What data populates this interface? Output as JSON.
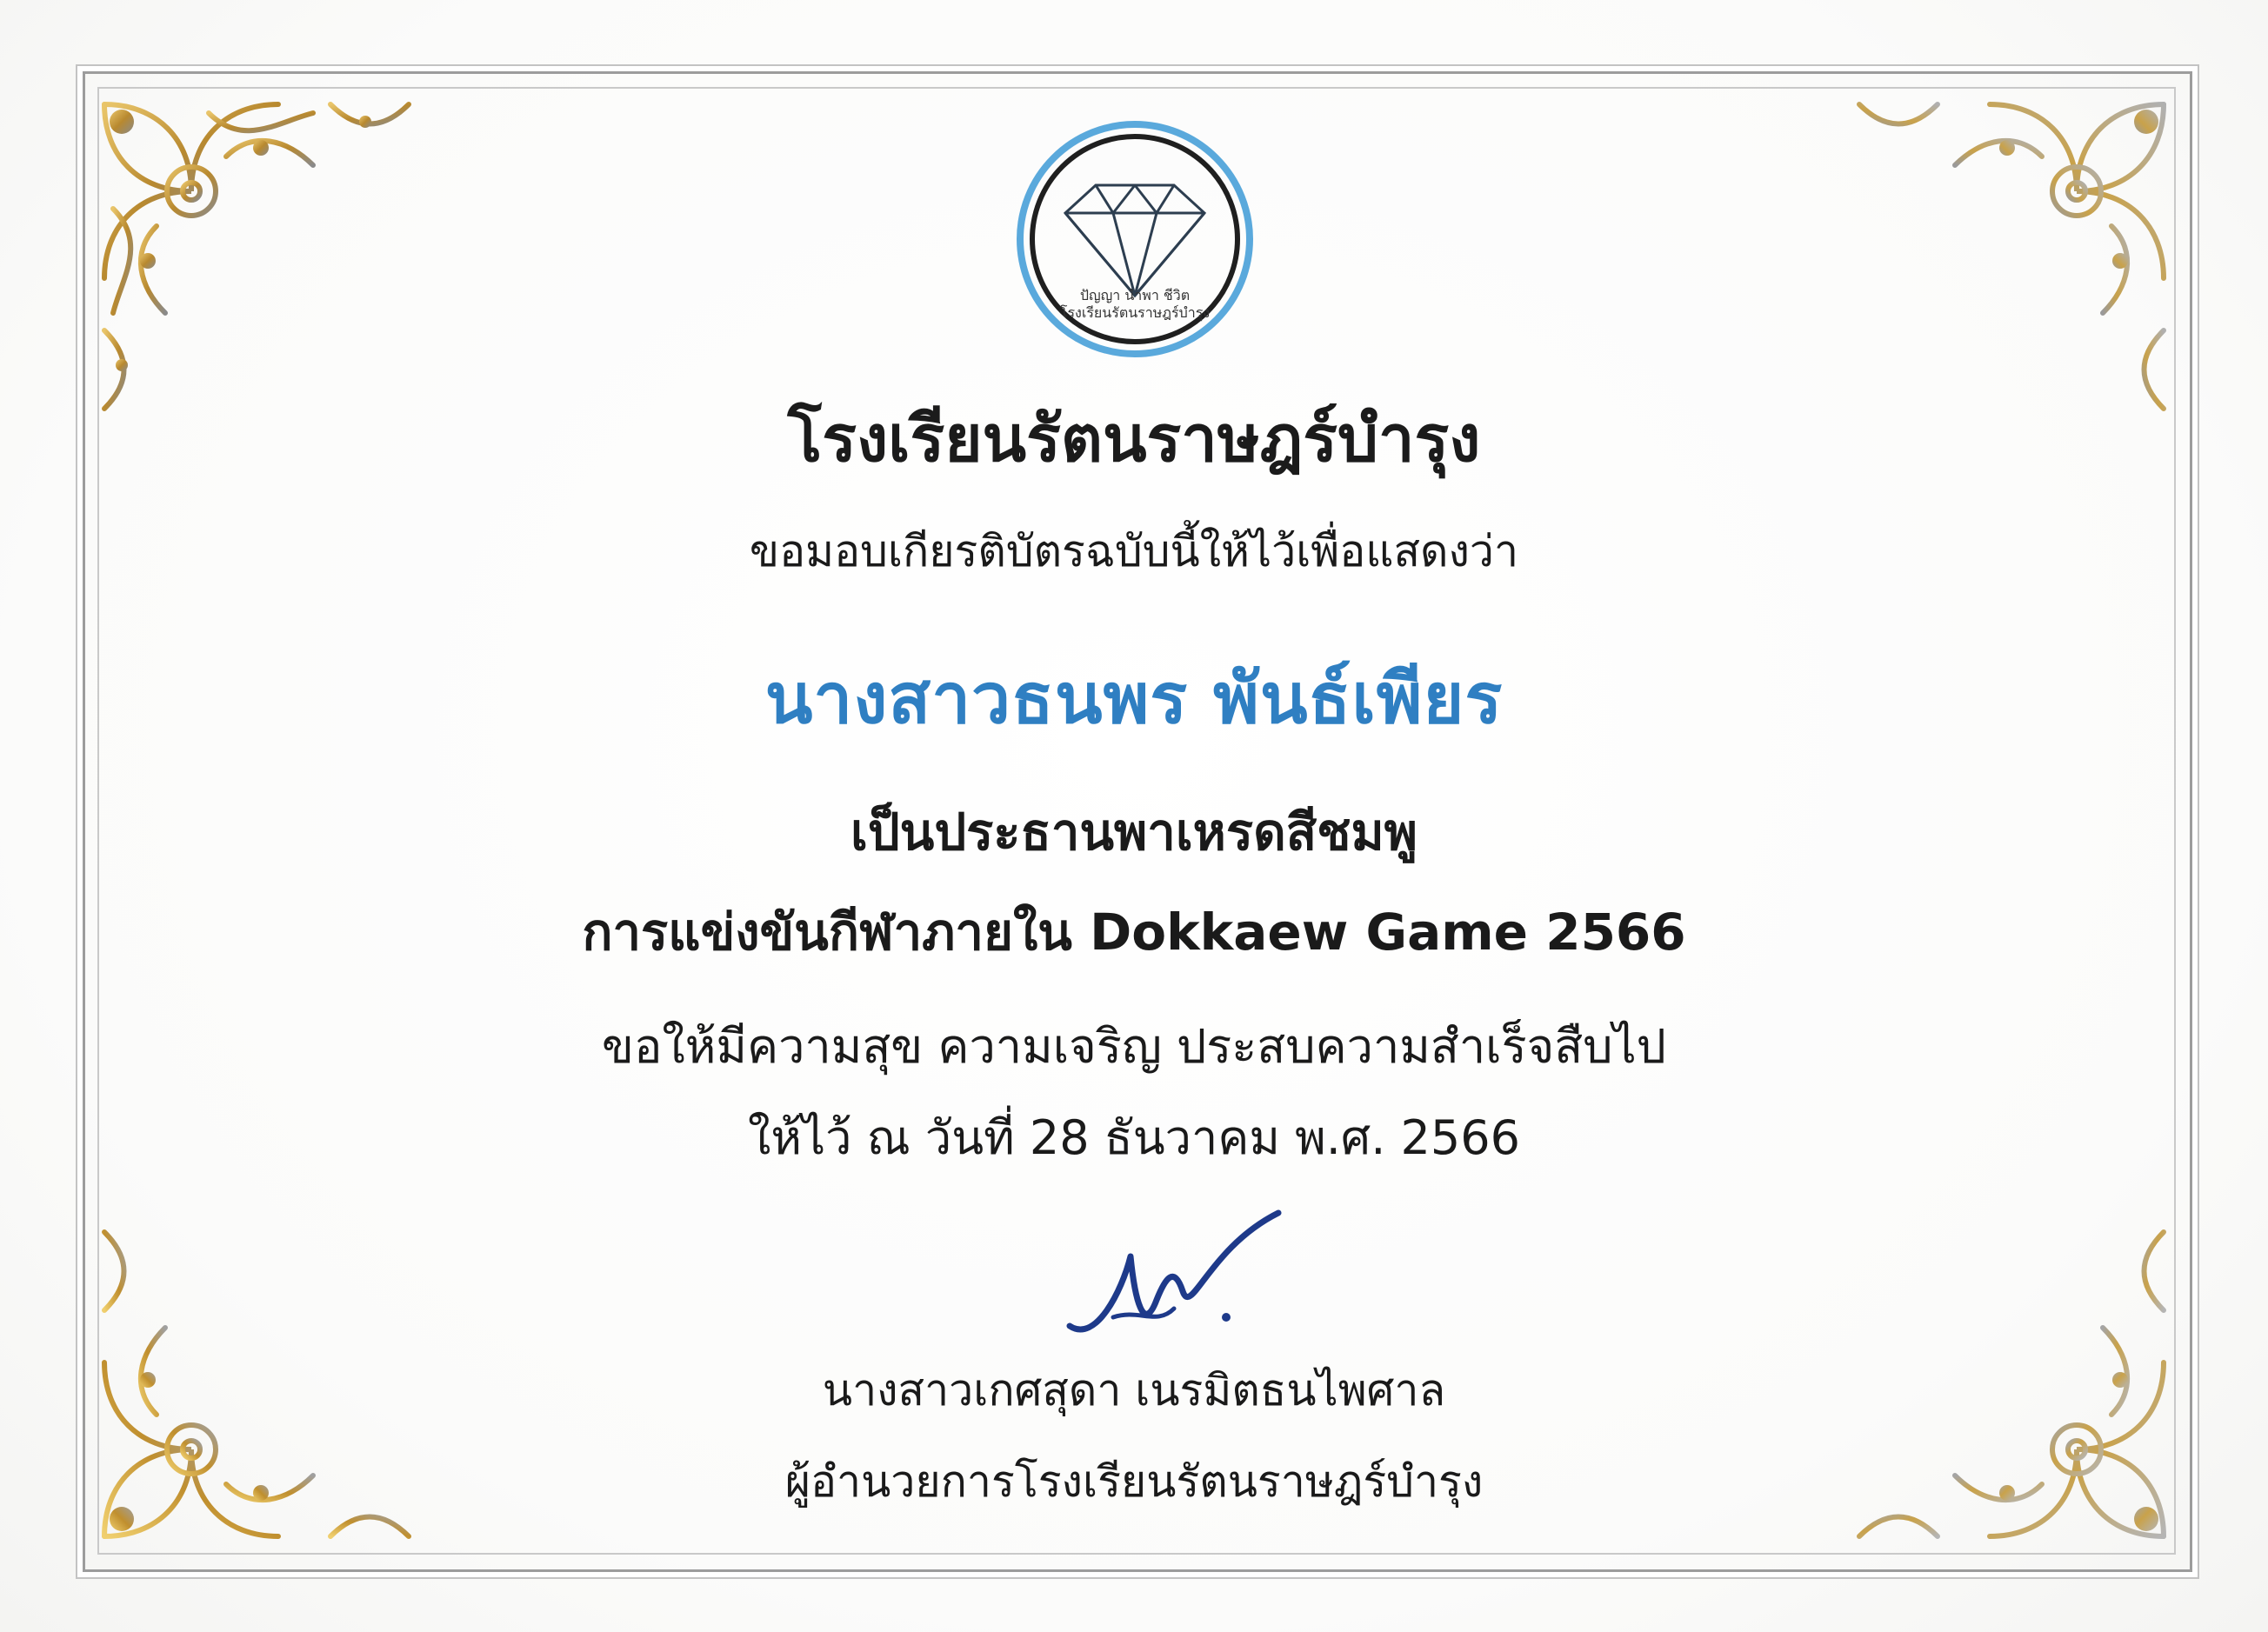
{
  "logo": {
    "icon": "diamond-logo-icon",
    "motto": "ปัญญา นำพา ชีวิต",
    "school_short": "โรงเรียนรัตนราษฎร์บำรุง"
  },
  "certificate": {
    "school": "โรงเรียนรัตนราษฎร์บำรุง",
    "intro": "ขอมอบเกียรติบัตรฉบับนี้ให้ไว้เพื่อแสดงว่า",
    "recipient": "นางสาวธนพร พันธ์เพียร",
    "role": "เป็นประธานพาเหรดสีชมพู",
    "event": "การแข่งขันกีฬาภายใน Dokkaew Game 2566",
    "wish": "ขอให้มีความสุข ความเจริญ ประสบความสำเร็จสืบไป",
    "date": "ให้ไว้ ณ วันที่ 28 ธันวาคม พ.ศ. 2566",
    "signer_name": "นางสาวเกศสุดา เนรมิตธนไพศาล",
    "signer_position": "ผู้อำนวยการโรงเรียนรัตนราษฎร์บำรุง"
  },
  "colors": {
    "recipient": "#2f7fc2",
    "gold": "#c9a24a",
    "frame": "#9c9c9c",
    "signature_ink": "#1e3a8a"
  }
}
